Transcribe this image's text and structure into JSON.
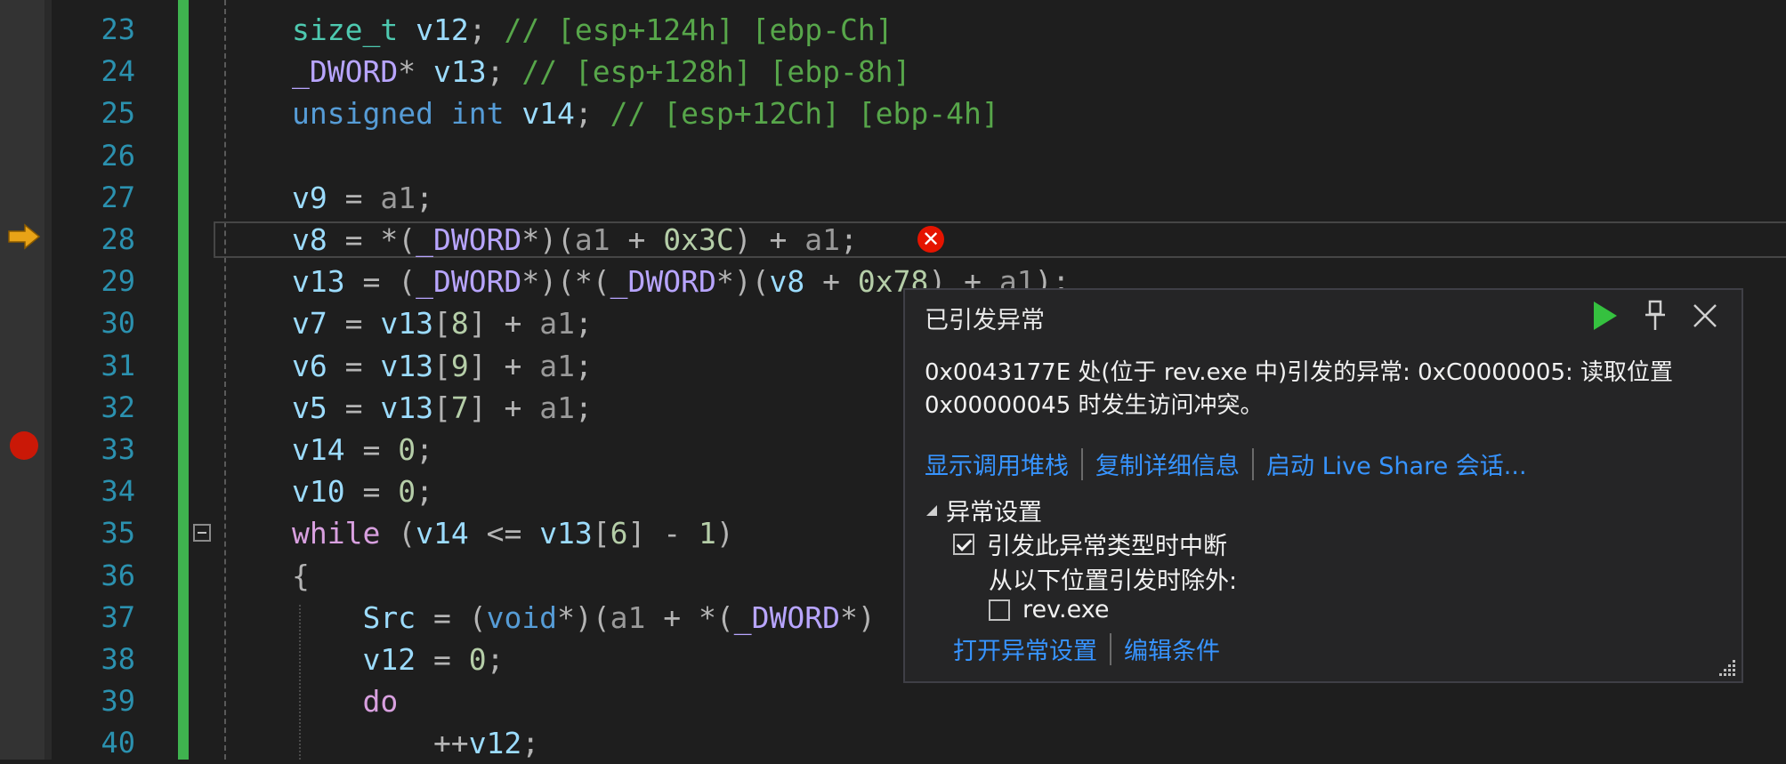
{
  "editor": {
    "lines": [
      {
        "num": "23",
        "tokens": [
          [
            "ty",
            "size_t"
          ],
          [
            "op",
            " "
          ],
          [
            "var",
            "v12"
          ],
          [
            "op",
            "; "
          ],
          [
            "cm",
            "// [esp+124h] [ebp-Ch]"
          ]
        ]
      },
      {
        "num": "24",
        "tokens": [
          [
            "mac",
            "_DWORD"
          ],
          [
            "op",
            "* "
          ],
          [
            "var",
            "v13"
          ],
          [
            "op",
            "; "
          ],
          [
            "cm",
            "// [esp+128h] [ebp-8h]"
          ]
        ]
      },
      {
        "num": "25",
        "tokens": [
          [
            "kw",
            "unsigned"
          ],
          [
            "op",
            " "
          ],
          [
            "kw",
            "int"
          ],
          [
            "op",
            " "
          ],
          [
            "var",
            "v14"
          ],
          [
            "op",
            "; "
          ],
          [
            "cm",
            "// [esp+12Ch] [ebp-4h]"
          ]
        ]
      },
      {
        "num": "26",
        "tokens": []
      },
      {
        "num": "27",
        "tokens": [
          [
            "var",
            "v9"
          ],
          [
            "op",
            " = "
          ],
          [
            "par",
            "a1"
          ],
          [
            "op",
            ";"
          ]
        ]
      },
      {
        "num": "28",
        "tokens": [
          [
            "var",
            "v8"
          ],
          [
            "op",
            " = *("
          ],
          [
            "mac",
            "_DWORD"
          ],
          [
            "op",
            "*)("
          ],
          [
            "par",
            "a1"
          ],
          [
            "op",
            " + "
          ],
          [
            "num",
            "0x3C"
          ],
          [
            "op",
            ") + "
          ],
          [
            "par",
            "a1"
          ],
          [
            "op",
            ";"
          ]
        ]
      },
      {
        "num": "29",
        "tokens": [
          [
            "var",
            "v13"
          ],
          [
            "op",
            " = ("
          ],
          [
            "mac",
            "_DWORD"
          ],
          [
            "op",
            "*)(*("
          ],
          [
            "mac",
            "_DWORD"
          ],
          [
            "op",
            "*)("
          ],
          [
            "var",
            "v8"
          ],
          [
            "op",
            " + "
          ],
          [
            "num",
            "0x78"
          ],
          [
            "op",
            ") + "
          ],
          [
            "par",
            "a1"
          ],
          [
            "op",
            ");"
          ]
        ]
      },
      {
        "num": "30",
        "tokens": [
          [
            "var",
            "v7"
          ],
          [
            "op",
            " = "
          ],
          [
            "var",
            "v13"
          ],
          [
            "op",
            "["
          ],
          [
            "num",
            "8"
          ],
          [
            "op",
            "] + "
          ],
          [
            "par",
            "a1"
          ],
          [
            "op",
            ";"
          ]
        ]
      },
      {
        "num": "31",
        "tokens": [
          [
            "var",
            "v6"
          ],
          [
            "op",
            " = "
          ],
          [
            "var",
            "v13"
          ],
          [
            "op",
            "["
          ],
          [
            "num",
            "9"
          ],
          [
            "op",
            "] + "
          ],
          [
            "par",
            "a1"
          ],
          [
            "op",
            ";"
          ]
        ]
      },
      {
        "num": "32",
        "tokens": [
          [
            "var",
            "v5"
          ],
          [
            "op",
            " = "
          ],
          [
            "var",
            "v13"
          ],
          [
            "op",
            "["
          ],
          [
            "num",
            "7"
          ],
          [
            "op",
            "] + "
          ],
          [
            "par",
            "a1"
          ],
          [
            "op",
            ";"
          ]
        ]
      },
      {
        "num": "33",
        "tokens": [
          [
            "var",
            "v14"
          ],
          [
            "op",
            " = "
          ],
          [
            "num",
            "0"
          ],
          [
            "op",
            ";"
          ]
        ]
      },
      {
        "num": "34",
        "tokens": [
          [
            "var",
            "v10"
          ],
          [
            "op",
            " = "
          ],
          [
            "num",
            "0"
          ],
          [
            "op",
            ";"
          ]
        ]
      },
      {
        "num": "35",
        "tokens": [
          [
            "ctl",
            "while"
          ],
          [
            "op",
            " ("
          ],
          [
            "var",
            "v14"
          ],
          [
            "op",
            " <= "
          ],
          [
            "var",
            "v13"
          ],
          [
            "op",
            "["
          ],
          [
            "num",
            "6"
          ],
          [
            "op",
            "] - "
          ],
          [
            "num",
            "1"
          ],
          [
            "op",
            ")"
          ]
        ]
      },
      {
        "num": "36",
        "tokens": [
          [
            "op",
            "{"
          ]
        ]
      },
      {
        "num": "37",
        "tokens": [
          [
            "op",
            "    "
          ],
          [
            "var",
            "Src"
          ],
          [
            "op",
            " = ("
          ],
          [
            "kw",
            "void"
          ],
          [
            "op",
            "*)("
          ],
          [
            "par",
            "a1"
          ],
          [
            "op",
            " + *("
          ],
          [
            "mac",
            "_DWORD"
          ],
          [
            "op",
            "*)"
          ]
        ]
      },
      {
        "num": "38",
        "tokens": [
          [
            "op",
            "    "
          ],
          [
            "var",
            "v12"
          ],
          [
            "op",
            " = "
          ],
          [
            "num",
            "0"
          ],
          [
            "op",
            ";"
          ]
        ]
      },
      {
        "num": "39",
        "tokens": [
          [
            "op",
            "    "
          ],
          [
            "ctl",
            "do"
          ]
        ]
      },
      {
        "num": "40",
        "tokens": [
          [
            "op",
            "        ++"
          ],
          [
            "var",
            "v12"
          ],
          [
            "op",
            ";"
          ]
        ]
      }
    ]
  },
  "exception": {
    "title": "已引发异常",
    "message": "0x0043177E 处(位于 rev.exe 中)引发的异常: 0xC0000005: 读取位置 0x00000045 时发生访问冲突。",
    "link_callstack": "显示调用堆栈",
    "link_copy": "复制详细信息",
    "link_liveshare": "启动 Live Share 会话...",
    "settings_header": "异常设置",
    "break_label": "引发此异常类型时中断",
    "except_label": "从以下位置引发时除外:",
    "module_label": "rev.exe",
    "link_open_settings": "打开异常设置",
    "link_edit_conditions": "编辑条件",
    "error_glyph": "✕"
  },
  "colors": {
    "line_number": "#2b91af",
    "change_bar": "#3fb34f",
    "breakpoint": "#e51400",
    "current_arrow": "#e8a317",
    "link": "#3794ff"
  }
}
